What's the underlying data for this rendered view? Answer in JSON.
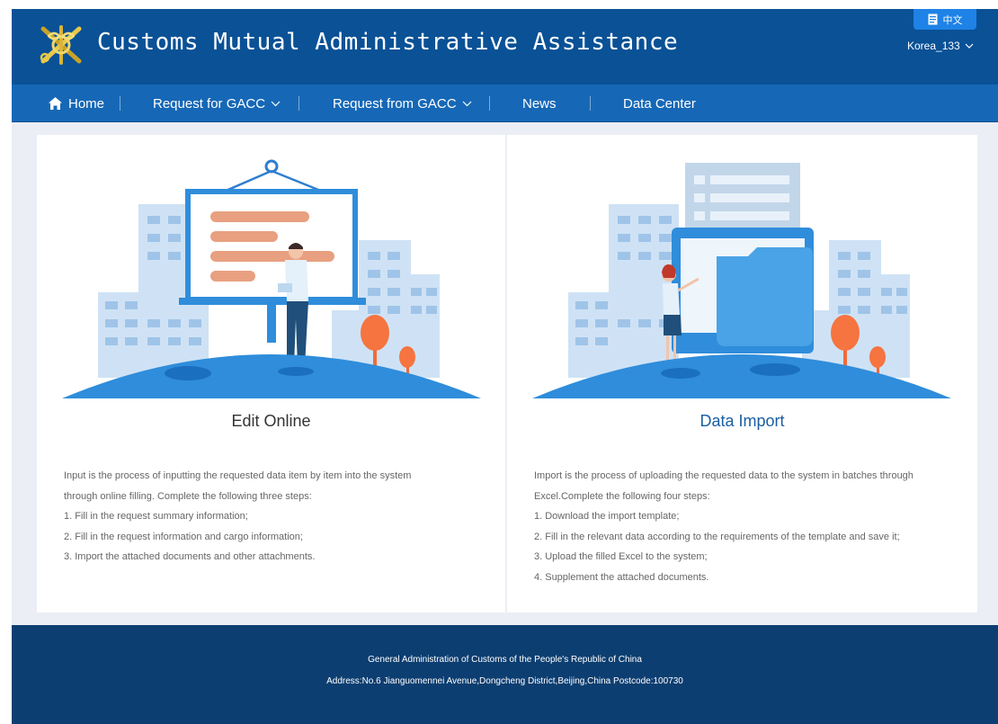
{
  "header": {
    "site_title": "Customs Mutual Administrative Assistance",
    "lang_label": "中文",
    "user_label": "Korea_133"
  },
  "nav": {
    "items": [
      {
        "label": "Home",
        "icon": "home-icon"
      },
      {
        "label": "Request for GACC",
        "dropdown": true
      },
      {
        "label": "Request from GACC",
        "dropdown": true
      },
      {
        "label": "News"
      },
      {
        "label": "Data Center"
      }
    ]
  },
  "cards": [
    {
      "title": "Edit Online",
      "lines": [
        "Input is the process of inputting the requested data item by item into the system",
        "through online filling. Complete the following three steps:",
        "1. Fill in the request summary information;",
        "2. Fill in the request information and cargo information;",
        "3. Import the attached documents and other attachments."
      ]
    },
    {
      "title": "Data Import",
      "lines": [
        "Import is the process of uploading the requested data to the system in batches through",
        "Excel.Complete the following four steps:",
        "1. Download the import template;",
        "2. Fill in the relevant data according to the requirements of the template and save it;",
        "3. Upload the filled Excel to the system;",
        "4. Supplement the attached documents."
      ]
    }
  ],
  "footer": {
    "line1": "General Administration of Customs of the People's Republic of China",
    "line2": "Address:No.6 Jianguomennei Avenue,Dongcheng District,Beijing,China Postcode:100730"
  },
  "colors": {
    "header_bg": "#0a5196",
    "nav_bg": "#1668b6",
    "footer_bg": "#0d3e71",
    "accent": "#1e82e6",
    "card_title_active": "#1b5ea3"
  }
}
